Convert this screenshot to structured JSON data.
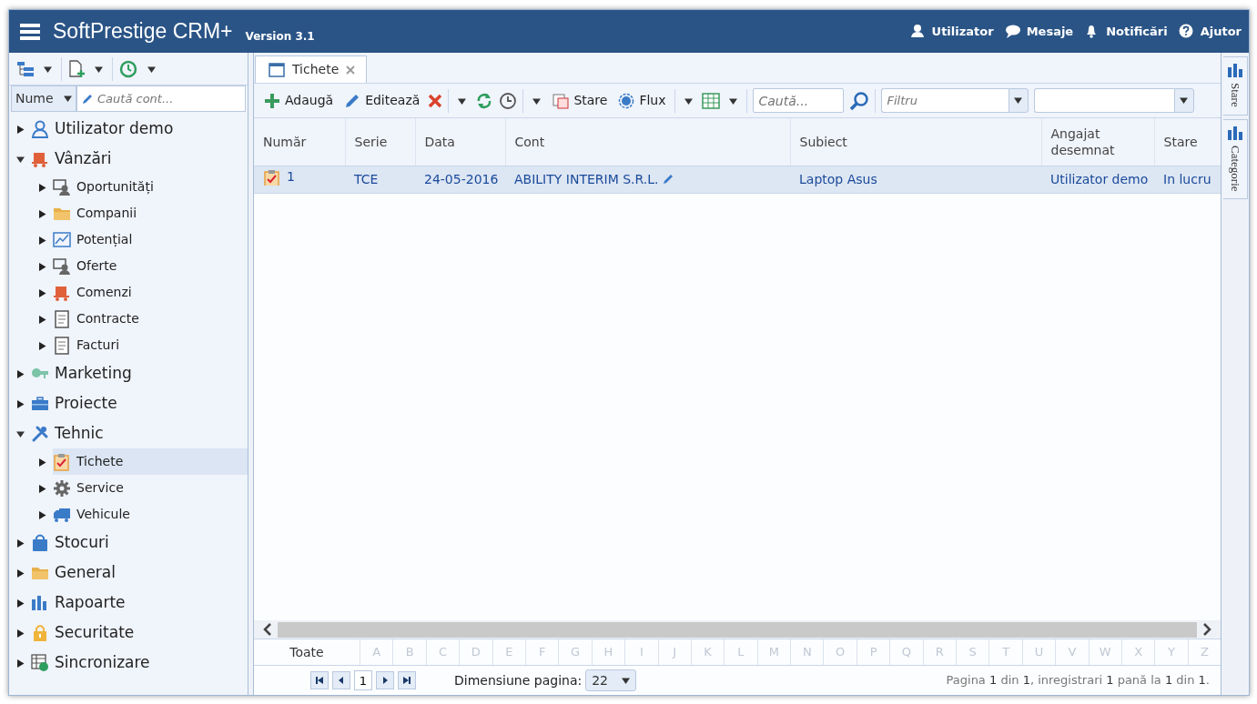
{
  "header": {
    "app_name": "SoftPrestige CRM+",
    "version": "Version 3.1",
    "links": [
      {
        "label": "Utilizator",
        "kind": "user"
      },
      {
        "label": "Mesaje",
        "kind": "chat"
      },
      {
        "label": "Notificări",
        "kind": "bell"
      },
      {
        "label": "Ajutor",
        "kind": "help"
      }
    ]
  },
  "sidebar": {
    "search": {
      "field_label": "Nume",
      "placeholder": "Caută cont..."
    },
    "tree": [
      {
        "label": "Utilizator demo",
        "kind": "user",
        "expanded": false,
        "selected": false
      },
      {
        "label": "Vânzări",
        "kind": "cart",
        "expanded": true,
        "selected": false,
        "children": [
          {
            "label": "Oportunități",
            "kind": "person",
            "expanded": false,
            "selected": false
          },
          {
            "label": "Companii",
            "kind": "folder",
            "expanded": false,
            "selected": false
          },
          {
            "label": "Potențial",
            "kind": "chart",
            "expanded": false,
            "selected": false
          },
          {
            "label": "Oferte",
            "kind": "person",
            "expanded": false,
            "selected": false
          },
          {
            "label": "Comenzi",
            "kind": "cart",
            "expanded": false,
            "selected": false
          },
          {
            "label": "Contracte",
            "kind": "doc",
            "expanded": false,
            "selected": false
          },
          {
            "label": "Facturi",
            "kind": "doc",
            "expanded": false,
            "selected": false
          }
        ]
      },
      {
        "label": "Marketing",
        "kind": "key",
        "expanded": false,
        "selected": false
      },
      {
        "label": "Proiecte",
        "kind": "case",
        "expanded": false,
        "selected": false
      },
      {
        "label": "Tehnic",
        "kind": "tools",
        "expanded": true,
        "selected": false,
        "children": [
          {
            "label": "Tichete",
            "kind": "ticket",
            "expanded": false,
            "selected": true
          },
          {
            "label": "Service",
            "kind": "gear",
            "expanded": false,
            "selected": false
          },
          {
            "label": "Vehicule",
            "kind": "truck",
            "expanded": false,
            "selected": false
          }
        ]
      },
      {
        "label": "Stocuri",
        "kind": "bag",
        "expanded": false,
        "selected": false
      },
      {
        "label": "General",
        "kind": "folder",
        "expanded": false,
        "selected": false
      },
      {
        "label": "Rapoarte",
        "kind": "bars",
        "expanded": false,
        "selected": false
      },
      {
        "label": "Securitate",
        "kind": "lock",
        "expanded": false,
        "selected": false
      },
      {
        "label": "Sincronizare",
        "kind": "sync",
        "expanded": false,
        "selected": false
      }
    ]
  },
  "tabs": [
    {
      "label": "Tichete",
      "selected": true
    }
  ],
  "toolbar": {
    "buttons": [
      {
        "label": "Adaugă",
        "kind": "add"
      },
      {
        "label": "Editează",
        "kind": "edit"
      },
      {
        "label": "Stare",
        "kind": "state"
      },
      {
        "label": "Flux",
        "kind": "flow"
      }
    ],
    "search_placeholder": "Caută...",
    "filter_placeholder": "Filtru"
  },
  "table": {
    "columns": [
      "Număr",
      "Serie",
      "Data",
      "Cont",
      "Subiect",
      "Angajat desemnat",
      "Stare"
    ],
    "rows": [
      {
        "selected": true,
        "cells": [
          "1",
          "TCE",
          "24-05-2016",
          "ABILITY INTERIM S.R.L.",
          "Laptop Asus",
          "Utilizator demo",
          "In lucru"
        ]
      }
    ]
  },
  "side_tabs": [
    "Stare",
    "Categorie"
  ],
  "alphabet": [
    "Toate",
    "A",
    "B",
    "C",
    "D",
    "E",
    "F",
    "G",
    "H",
    "I",
    "J",
    "K",
    "L",
    "M",
    "N",
    "O",
    "P",
    "Q",
    "R",
    "S",
    "T",
    "U",
    "V",
    "W",
    "X",
    "Y",
    "Z"
  ],
  "pager": {
    "page": "1",
    "size_label": "Dimensiune pagina:",
    "size": "22",
    "summary": "Pagina **1** din **1**, inregistrari **1** pană la **1** din **1**."
  }
}
